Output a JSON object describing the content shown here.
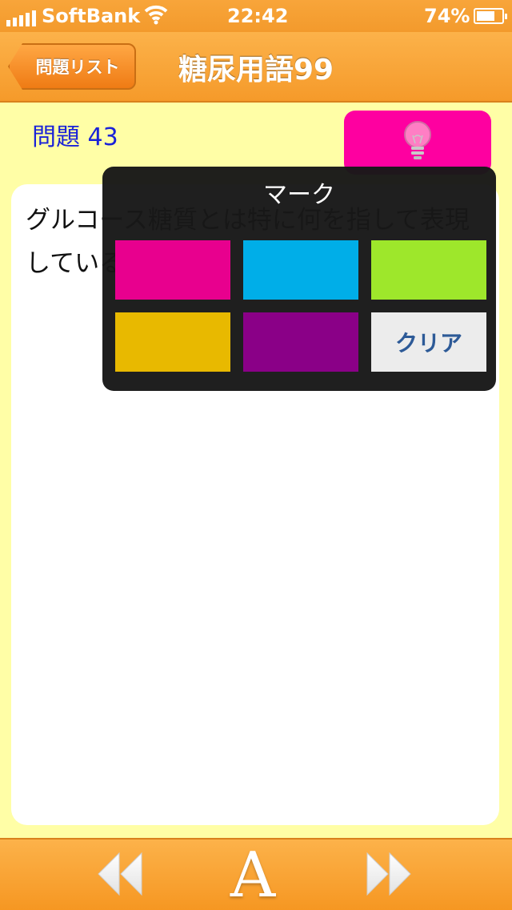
{
  "status_bar": {
    "carrier": "SoftBank",
    "time": "22:42",
    "battery": "74%",
    "battery_level": 0.74,
    "icons": [
      "signal-icon",
      "wifi-icon",
      "battery-icon"
    ]
  },
  "nav": {
    "back_label": "問題リスト",
    "title": "糖尿用語99"
  },
  "question": {
    "label": "問題 43",
    "text": "グルコース糖質とは特に何を指して表現しているのですか"
  },
  "hint_button": {
    "icon": "lightbulb-icon"
  },
  "mark_popover": {
    "title": "マーク",
    "swatches": [
      {
        "color": "#e8008e"
      },
      {
        "color": "#00aee8"
      },
      {
        "color": "#9ee72b"
      },
      {
        "color": "#e8b900"
      },
      {
        "color": "#8a0087"
      }
    ],
    "clear_label": "クリア"
  },
  "toolbar": {
    "prev_icon": "rewind-icon",
    "font_label": "A",
    "next_icon": "fast-forward-icon"
  },
  "colors": {
    "accent_orange": "#f7a43a",
    "background_yellow": "#fffea6",
    "hint_pink": "#fe00a0",
    "question_blue": "#1a22d8"
  }
}
